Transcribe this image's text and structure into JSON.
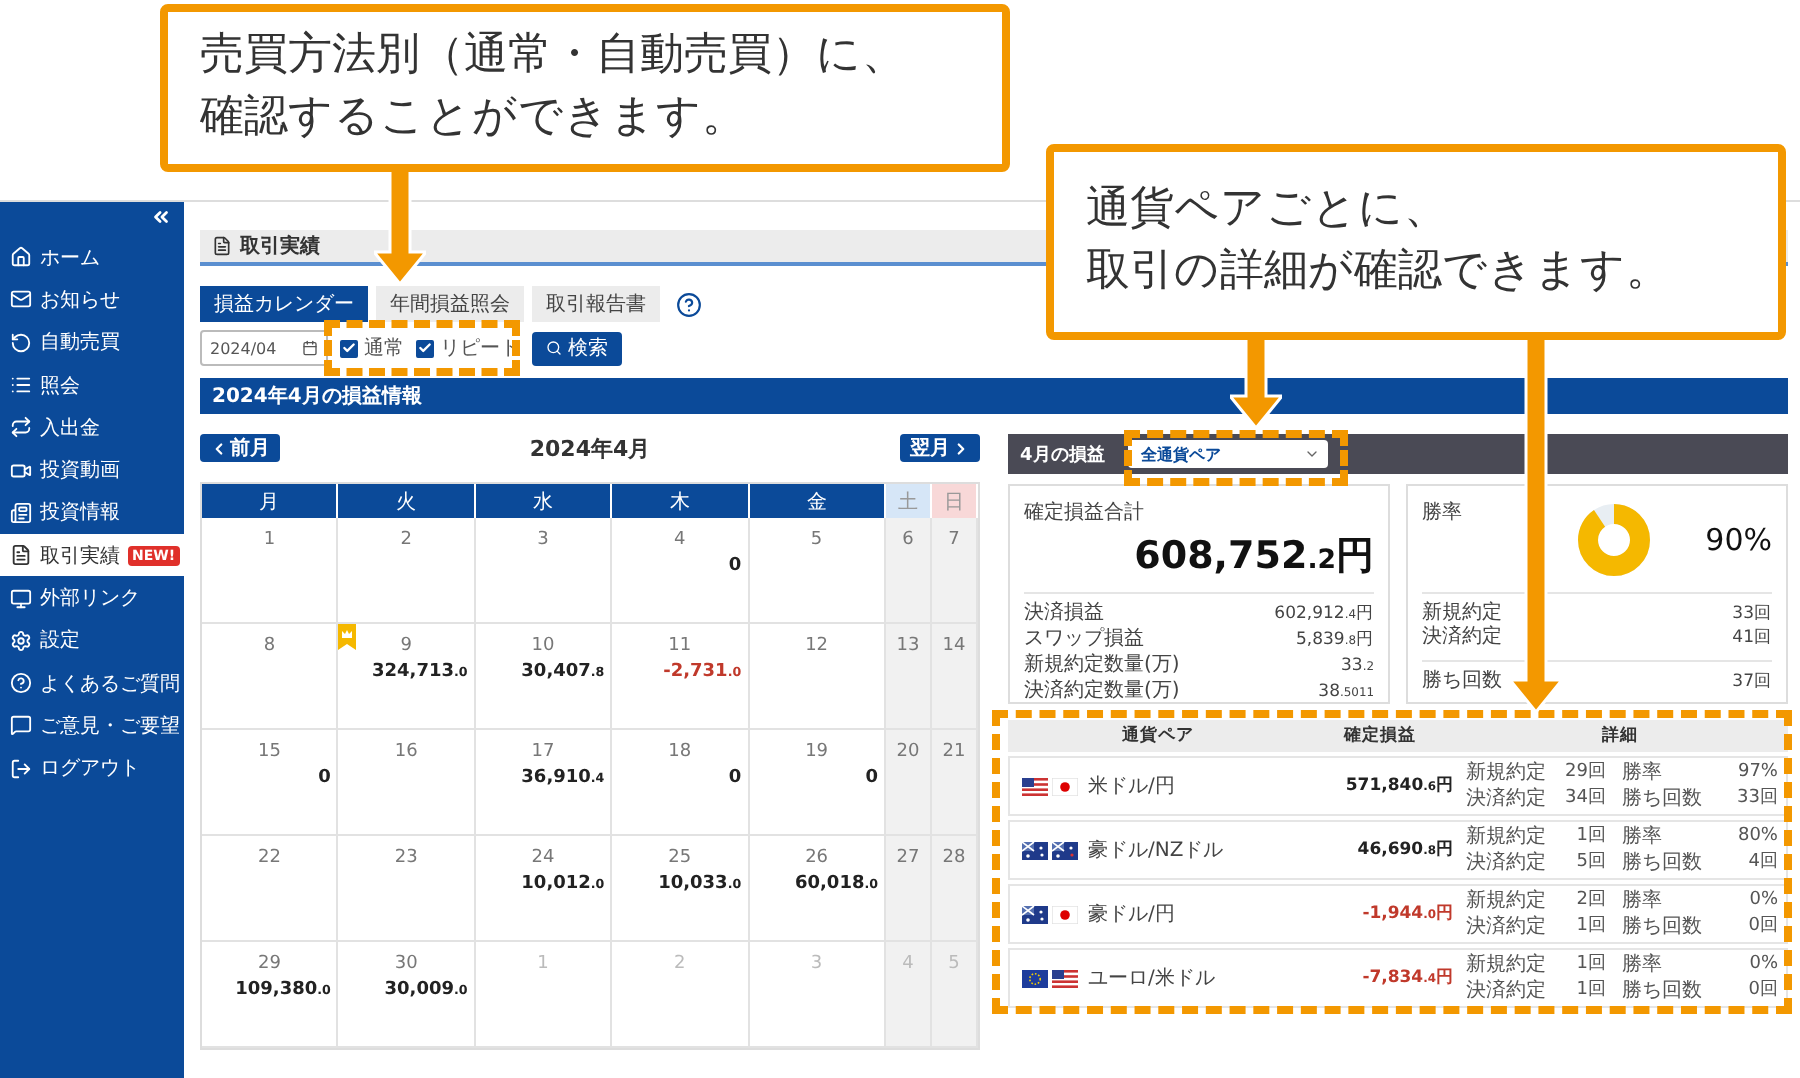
{
  "callouts": [
    {
      "lines": [
        "売買方法別（通常・自動売買）に、",
        "確認することができます。"
      ]
    },
    {
      "lines": [
        "通貨ペアごとに、",
        "取引の詳細が確認できます。"
      ]
    }
  ],
  "sidebar": {
    "items": [
      {
        "label": "ホーム",
        "selected": false
      },
      {
        "label": "お知らせ",
        "selected": false
      },
      {
        "label": "自動売買",
        "selected": false
      },
      {
        "label": "照会",
        "selected": false
      },
      {
        "label": "入出金",
        "selected": false
      },
      {
        "label": "投資動画",
        "selected": false
      },
      {
        "label": "投資情報",
        "selected": false
      },
      {
        "label": "取引実績",
        "selected": true,
        "badge": "NEW!"
      },
      {
        "label": "外部リンク",
        "selected": false
      },
      {
        "label": "設定",
        "selected": false
      },
      {
        "label": "よくあるご質問",
        "selected": false
      },
      {
        "label": "ご意見・ご要望",
        "selected": false
      },
      {
        "label": "ログアウト",
        "selected": false
      }
    ]
  },
  "page_title": "取引実績",
  "tabs": [
    {
      "label": "損益カレンダー",
      "selected": true
    },
    {
      "label": "年間損益照会",
      "selected": false
    },
    {
      "label": "取引報告書",
      "selected": false
    }
  ],
  "filter": {
    "month": "2024/04",
    "checkboxes": [
      {
        "label": "通常",
        "checked": true
      },
      {
        "label": "リピート",
        "checked": true
      }
    ],
    "search": "検索"
  },
  "section_title": "2024年4月の損益情報",
  "calendar": {
    "prev": "前月",
    "title": "2024年4月",
    "next": "翌月",
    "weekdays": [
      {
        "label": "月",
        "kind": "weekday"
      },
      {
        "label": "火",
        "kind": "weekday"
      },
      {
        "label": "水",
        "kind": "weekday"
      },
      {
        "label": "木",
        "kind": "weekday"
      },
      {
        "label": "金",
        "kind": "weekday"
      },
      {
        "label": "土",
        "kind": "saturday"
      },
      {
        "label": "日",
        "kind": "sunday"
      }
    ],
    "weeks": [
      [
        {
          "day": "1",
          "outside": false,
          "marked": false
        },
        {
          "day": "2",
          "outside": false,
          "marked": false
        },
        {
          "day": "3",
          "outside": false,
          "marked": false
        },
        {
          "day": "4",
          "value": "0",
          "negative": false,
          "outside": false,
          "marked": false
        },
        {
          "day": "5",
          "outside": false,
          "marked": false
        },
        {
          "day": "6",
          "outside": false,
          "marked": false
        },
        {
          "day": "7",
          "outside": false,
          "marked": false
        }
      ],
      [
        {
          "day": "8",
          "outside": false,
          "marked": false
        },
        {
          "day": "9",
          "value": "324,713.0",
          "negative": false,
          "outside": false,
          "marked": true
        },
        {
          "day": "10",
          "value": "30,407.8",
          "negative": false,
          "outside": false,
          "marked": false
        },
        {
          "day": "11",
          "value": "-2,731.0",
          "negative": true,
          "outside": false,
          "marked": false
        },
        {
          "day": "12",
          "outside": false,
          "marked": false
        },
        {
          "day": "13",
          "outside": false,
          "marked": false
        },
        {
          "day": "14",
          "outside": false,
          "marked": false
        }
      ],
      [
        {
          "day": "15",
          "value": "0",
          "negative": false,
          "outside": false,
          "marked": false
        },
        {
          "day": "16",
          "outside": false,
          "marked": false
        },
        {
          "day": "17",
          "value": "36,910.4",
          "negative": false,
          "outside": false,
          "marked": false
        },
        {
          "day": "18",
          "value": "0",
          "negative": false,
          "outside": false,
          "marked": false
        },
        {
          "day": "19",
          "value": "0",
          "negative": false,
          "outside": false,
          "marked": false
        },
        {
          "day": "20",
          "outside": false,
          "marked": false
        },
        {
          "day": "21",
          "outside": false,
          "marked": false
        }
      ],
      [
        {
          "day": "22",
          "outside": false,
          "marked": false
        },
        {
          "day": "23",
          "outside": false,
          "marked": false
        },
        {
          "day": "24",
          "value": "10,012.0",
          "negative": false,
          "outside": false,
          "marked": false
        },
        {
          "day": "25",
          "value": "10,033.0",
          "negative": false,
          "outside": false,
          "marked": false
        },
        {
          "day": "26",
          "value": "60,018.0",
          "negative": false,
          "outside": false,
          "marked": false
        },
        {
          "day": "27",
          "outside": false,
          "marked": false
        },
        {
          "day": "28",
          "outside": false,
          "marked": false
        }
      ],
      [
        {
          "day": "29",
          "value": "109,380.0",
          "negative": false,
          "outside": false,
          "marked": false
        },
        {
          "day": "30",
          "value": "30,009.0",
          "negative": false,
          "outside": false,
          "marked": false
        },
        {
          "day": "1",
          "outside": true,
          "marked": false
        },
        {
          "day": "2",
          "outside": true,
          "marked": false
        },
        {
          "day": "3",
          "outside": true,
          "marked": false
        },
        {
          "day": "4",
          "outside": true,
          "marked": false
        },
        {
          "day": "5",
          "outside": true,
          "marked": false
        }
      ]
    ]
  },
  "summary": {
    "title": "4月の損益",
    "pair_select": "全通貨ペア",
    "total": {
      "label": "確定損益合計",
      "value": "608,752.2円",
      "rows": [
        {
          "label": "決済損益",
          "value": "602,912.4円"
        },
        {
          "label": "スワップ損益",
          "value": "5,839.8円"
        },
        {
          "label": "新規約定数量(万)",
          "value": "33.2"
        },
        {
          "label": "決済約定数量(万)",
          "value": "38.5011"
        }
      ]
    },
    "win": {
      "label": "勝率",
      "value": "90%",
      "level": 0.9,
      "rows": [
        {
          "label": "新規約定",
          "value": "33回"
        },
        {
          "label": "決済約定",
          "value": "41回"
        }
      ],
      "extra_rows": [
        {
          "label": "勝ち回数",
          "value": "37回"
        }
      ]
    }
  },
  "pairs_table": {
    "columns": [
      "通貨ペア",
      "確定損益",
      "詳細"
    ],
    "rows": [
      {
        "name": "米ドル/円",
        "profit": "571,840.6円",
        "negative": false,
        "details": [
          [
            "新規約定",
            "29回",
            "勝率",
            "97%"
          ],
          [
            "決済約定",
            "34回",
            "勝ち回数",
            "33回"
          ]
        ]
      },
      {
        "name": "豪ドル/NZドル",
        "profit": "46,690.8円",
        "negative": false,
        "details": [
          [
            "新規約定",
            "1回",
            "勝率",
            "80%"
          ],
          [
            "決済約定",
            "5回",
            "勝ち回数",
            "4回"
          ]
        ]
      },
      {
        "name": "豪ドル/円",
        "profit": "-1,944.0円",
        "negative": true,
        "details": [
          [
            "新規約定",
            "2回",
            "勝率",
            "0%"
          ],
          [
            "決済約定",
            "1回",
            "勝ち回数",
            "0回"
          ]
        ]
      },
      {
        "name": "ユーロ/米ドル",
        "profit": "-7,834.4円",
        "negative": true,
        "details": [
          [
            "新規約定",
            "1回",
            "勝率",
            "0%"
          ],
          [
            "決済約定",
            "1回",
            "勝ち回数",
            "0回"
          ]
        ]
      }
    ]
  }
}
